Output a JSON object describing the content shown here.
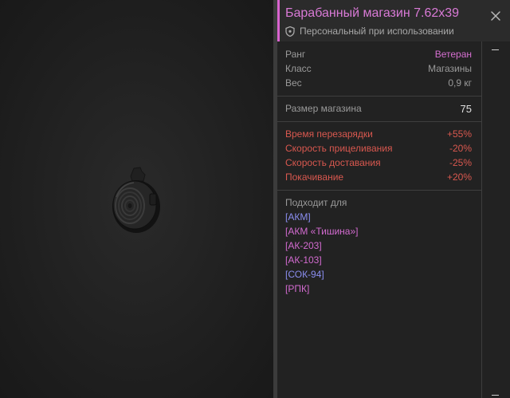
{
  "item": {
    "title": "Барабанный магазин 7.62x39",
    "binding": "Персональный при использовании",
    "title_color": "#d97ad6",
    "accent_color": "#d963cf"
  },
  "icons": {
    "close": "close-icon",
    "binding": "shield-icon",
    "item": "drum-magazine-image"
  },
  "stats": [
    {
      "label": "Ранг",
      "value": "Ветеран",
      "value_color": "#d56fd0"
    },
    {
      "label": "Класс",
      "value": "Магазины"
    },
    {
      "label": "Вес",
      "value": "0,9 кг"
    }
  ],
  "capacity": {
    "label": "Размер магазина",
    "value": "75"
  },
  "modifiers": [
    {
      "label": "Время перезарядки",
      "value": "+55%"
    },
    {
      "label": "Скорость прицеливания",
      "value": "-20%"
    },
    {
      "label": "Скорость доставания",
      "value": "-25%"
    },
    {
      "label": "Покачивание",
      "value": "+20%"
    }
  ],
  "negative_color": "#d9584f",
  "fits": {
    "title": "Подходит для",
    "weapons": [
      {
        "name": "[АКМ]",
        "color": "#8b8ef0"
      },
      {
        "name": "[АКМ «Тишина»]",
        "color": "#d36bd0"
      },
      {
        "name": "[АК-203]",
        "color": "#d36bd0"
      },
      {
        "name": "[АК-103]",
        "color": "#d36bd0"
      },
      {
        "name": "[СОК-94]",
        "color": "#8b8ef0"
      },
      {
        "name": "[РПК]",
        "color": "#d36bd0"
      }
    ]
  }
}
